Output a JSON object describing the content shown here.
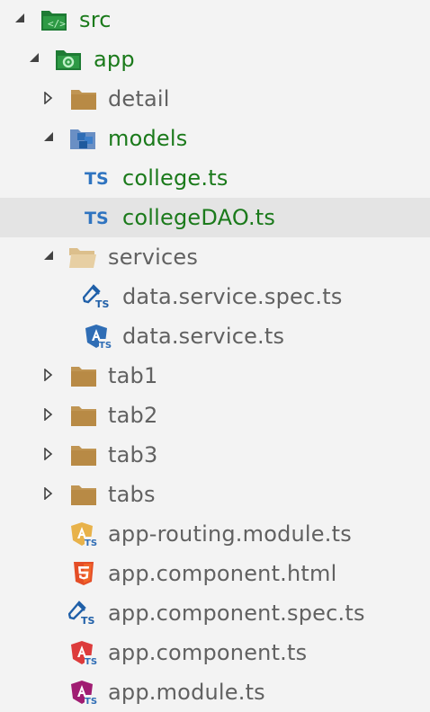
{
  "explorer": {
    "items": [
      {
        "label": "src",
        "icon": "src-folder-icon",
        "expanded": true,
        "color": "#1b7a1b"
      },
      {
        "label": "app",
        "icon": "app-folder-icon",
        "expanded": true,
        "color": "#1b7a1b"
      },
      {
        "label": "detail",
        "icon": "folder-icon",
        "expanded": false
      },
      {
        "label": "models",
        "icon": "models-folder-icon",
        "expanded": true,
        "color": "#1b7a1b"
      },
      {
        "label": "college.ts",
        "icon": "typescript-icon",
        "color": "#1b7a1b"
      },
      {
        "label": "collegeDAO.ts",
        "icon": "typescript-icon",
        "selected": true,
        "color": "#1b7a1b"
      },
      {
        "label": "services",
        "icon": "open-folder-icon",
        "expanded": true
      },
      {
        "label": "data.service.spec.ts",
        "icon": "spec-test-icon"
      },
      {
        "label": "data.service.ts",
        "icon": "angular-service-icon"
      },
      {
        "label": "tab1",
        "icon": "folder-icon",
        "expanded": false
      },
      {
        "label": "tab2",
        "icon": "folder-icon",
        "expanded": false
      },
      {
        "label": "tab3",
        "icon": "folder-icon",
        "expanded": false
      },
      {
        "label": "tabs",
        "icon": "folder-icon",
        "expanded": false
      },
      {
        "label": "app-routing.module.ts",
        "icon": "angular-routing-icon"
      },
      {
        "label": "app.component.html",
        "icon": "html5-icon"
      },
      {
        "label": "app.component.spec.ts",
        "icon": "spec-test-icon"
      },
      {
        "label": "app.component.ts",
        "icon": "angular-component-icon"
      },
      {
        "label": "app.module.ts",
        "icon": "angular-module-icon"
      }
    ],
    "ts_badge": "TS"
  }
}
